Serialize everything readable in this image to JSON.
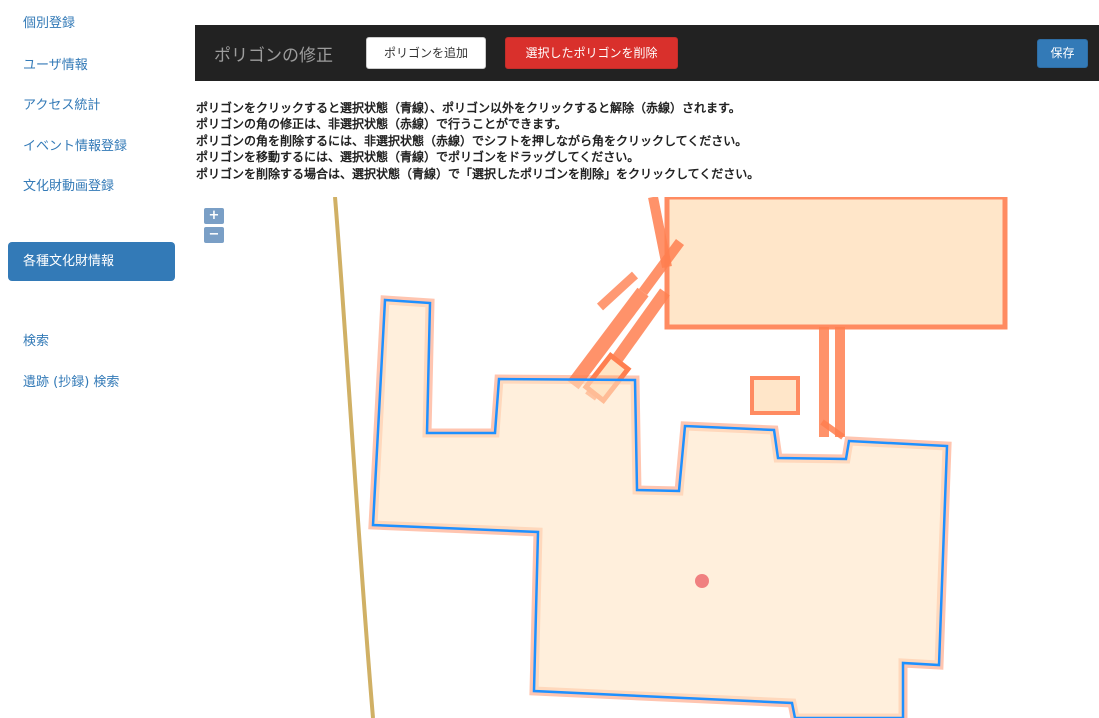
{
  "sidebar": {
    "items": [
      {
        "label": "個別登録"
      },
      {
        "label": "ユーザ情報"
      },
      {
        "label": "アクセス統計"
      },
      {
        "label": "イベント情報登録"
      },
      {
        "label": "文化財動画登録"
      },
      {
        "label": "各種文化財情報",
        "active": true
      },
      {
        "label": "検索"
      },
      {
        "label": "遺跡 (抄録) 検索"
      }
    ]
  },
  "header": {
    "title": "ポリゴンの修正",
    "add_button": "ポリゴンを追加",
    "delete_button": "選択したポリゴンを削除",
    "save_button": "保存"
  },
  "instructions": [
    "ポリゴンをクリックすると選択状態（青線）、ポリゴン以外をクリックすると解除（赤線）されます。",
    "ポリゴンの角の修正は、非選択状態（赤線）で行うことができます。",
    "ポリゴンの角を削除するには、非選択状態（赤線）でシフトを押しながら角をクリックしてください。",
    "ポリゴンを移動するには、選択状態（青線）でポリゴンをドラッグしてください。",
    "ポリゴンを削除する場合は、選択状態（青線）で「選択したポリゴンを削除」をクリックしてください。"
  ],
  "map": {
    "zoom_in": "+",
    "zoom_out": "−",
    "colors": {
      "selected_stroke": "#1e90ff",
      "unselected_stroke": "#ff7f50",
      "fill": "#ffe4c4",
      "centroid": "#f08080",
      "road": "#c8a24a"
    }
  }
}
